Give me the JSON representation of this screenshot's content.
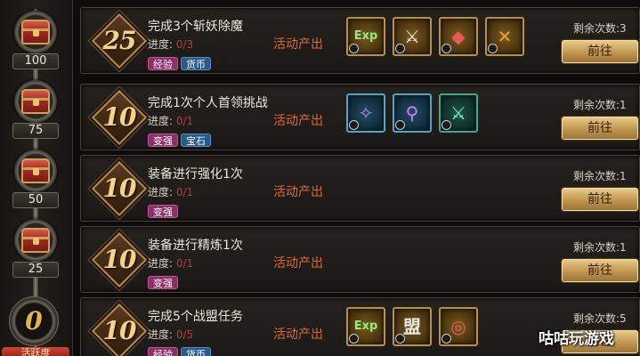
{
  "milestones": [
    {
      "value": "100"
    },
    {
      "value": "75"
    },
    {
      "value": "50"
    },
    {
      "value": "25"
    }
  ],
  "current_activity": "0",
  "activity_banner": "活跃度",
  "tasks": [
    {
      "points": "25",
      "title": "完成3个斩妖除魔",
      "progress_label": "进度:",
      "progress_value": "0/3",
      "tags": [
        "经验",
        "货币"
      ],
      "source": "活动产出",
      "rewards": [
        {
          "icon": "exp-icon",
          "text": "Exp"
        },
        {
          "icon": "winged-sword-icon",
          "text": "⚔"
        },
        {
          "icon": "red-gem-emblem-icon",
          "text": "◆"
        },
        {
          "icon": "crossed-swords-emblem-icon",
          "text": "✕"
        }
      ],
      "remaining_label": "剩余次数:",
      "remaining_value": "3",
      "button": "前往"
    },
    {
      "points": "10",
      "title": "完成1次个人首领挑战",
      "progress_label": "进度:",
      "progress_value": "0/1",
      "tags": [
        "变强",
        "宝石"
      ],
      "source": "活动产出",
      "rewards": [
        {
          "icon": "pink-crystal-icon",
          "text": "✧"
        },
        {
          "icon": "purple-ring-crystal-icon",
          "text": "⚲"
        },
        {
          "icon": "green-crystal-icon",
          "text": "⚔"
        }
      ],
      "remaining_label": "剩余次数:",
      "remaining_value": "1",
      "button": "前往"
    },
    {
      "points": "10",
      "title": "装备进行强化1次",
      "progress_label": "进度:",
      "progress_value": "0/1",
      "tags": [
        "变强"
      ],
      "source": "活动产出",
      "rewards": [],
      "remaining_label": "剩余次数:",
      "remaining_value": "1",
      "button": "前往"
    },
    {
      "points": "10",
      "title": "装备进行精炼1次",
      "progress_label": "进度:",
      "progress_value": "0/1",
      "tags": [
        "变强"
      ],
      "source": "活动产出",
      "rewards": [],
      "remaining_label": "剩余次数:",
      "remaining_value": "1",
      "button": "前往"
    },
    {
      "points": "10",
      "title": "完成5个战盟任务",
      "progress_label": "进度:",
      "progress_value": "0/5",
      "tags": [
        "经验",
        "货币"
      ],
      "source": "活动产出",
      "rewards": [
        {
          "icon": "exp-icon",
          "text": "Exp"
        },
        {
          "icon": "guild-token-icon",
          "text": "盟"
        },
        {
          "icon": "gold-coins-icon",
          "text": "◎"
        }
      ],
      "remaining_label": "剩余次数:",
      "remaining_value": "5",
      "button": "前往"
    }
  ],
  "watermark": "咕咕玩游戏",
  "colors": {
    "progress_value": "#c23a2a",
    "source_text": "#e06a2e",
    "tag_pink": "#8f2d6c",
    "tag_blue": "#2a5a8a",
    "button_gold": "#c59a55",
    "points_gold": "#f3d48a"
  }
}
